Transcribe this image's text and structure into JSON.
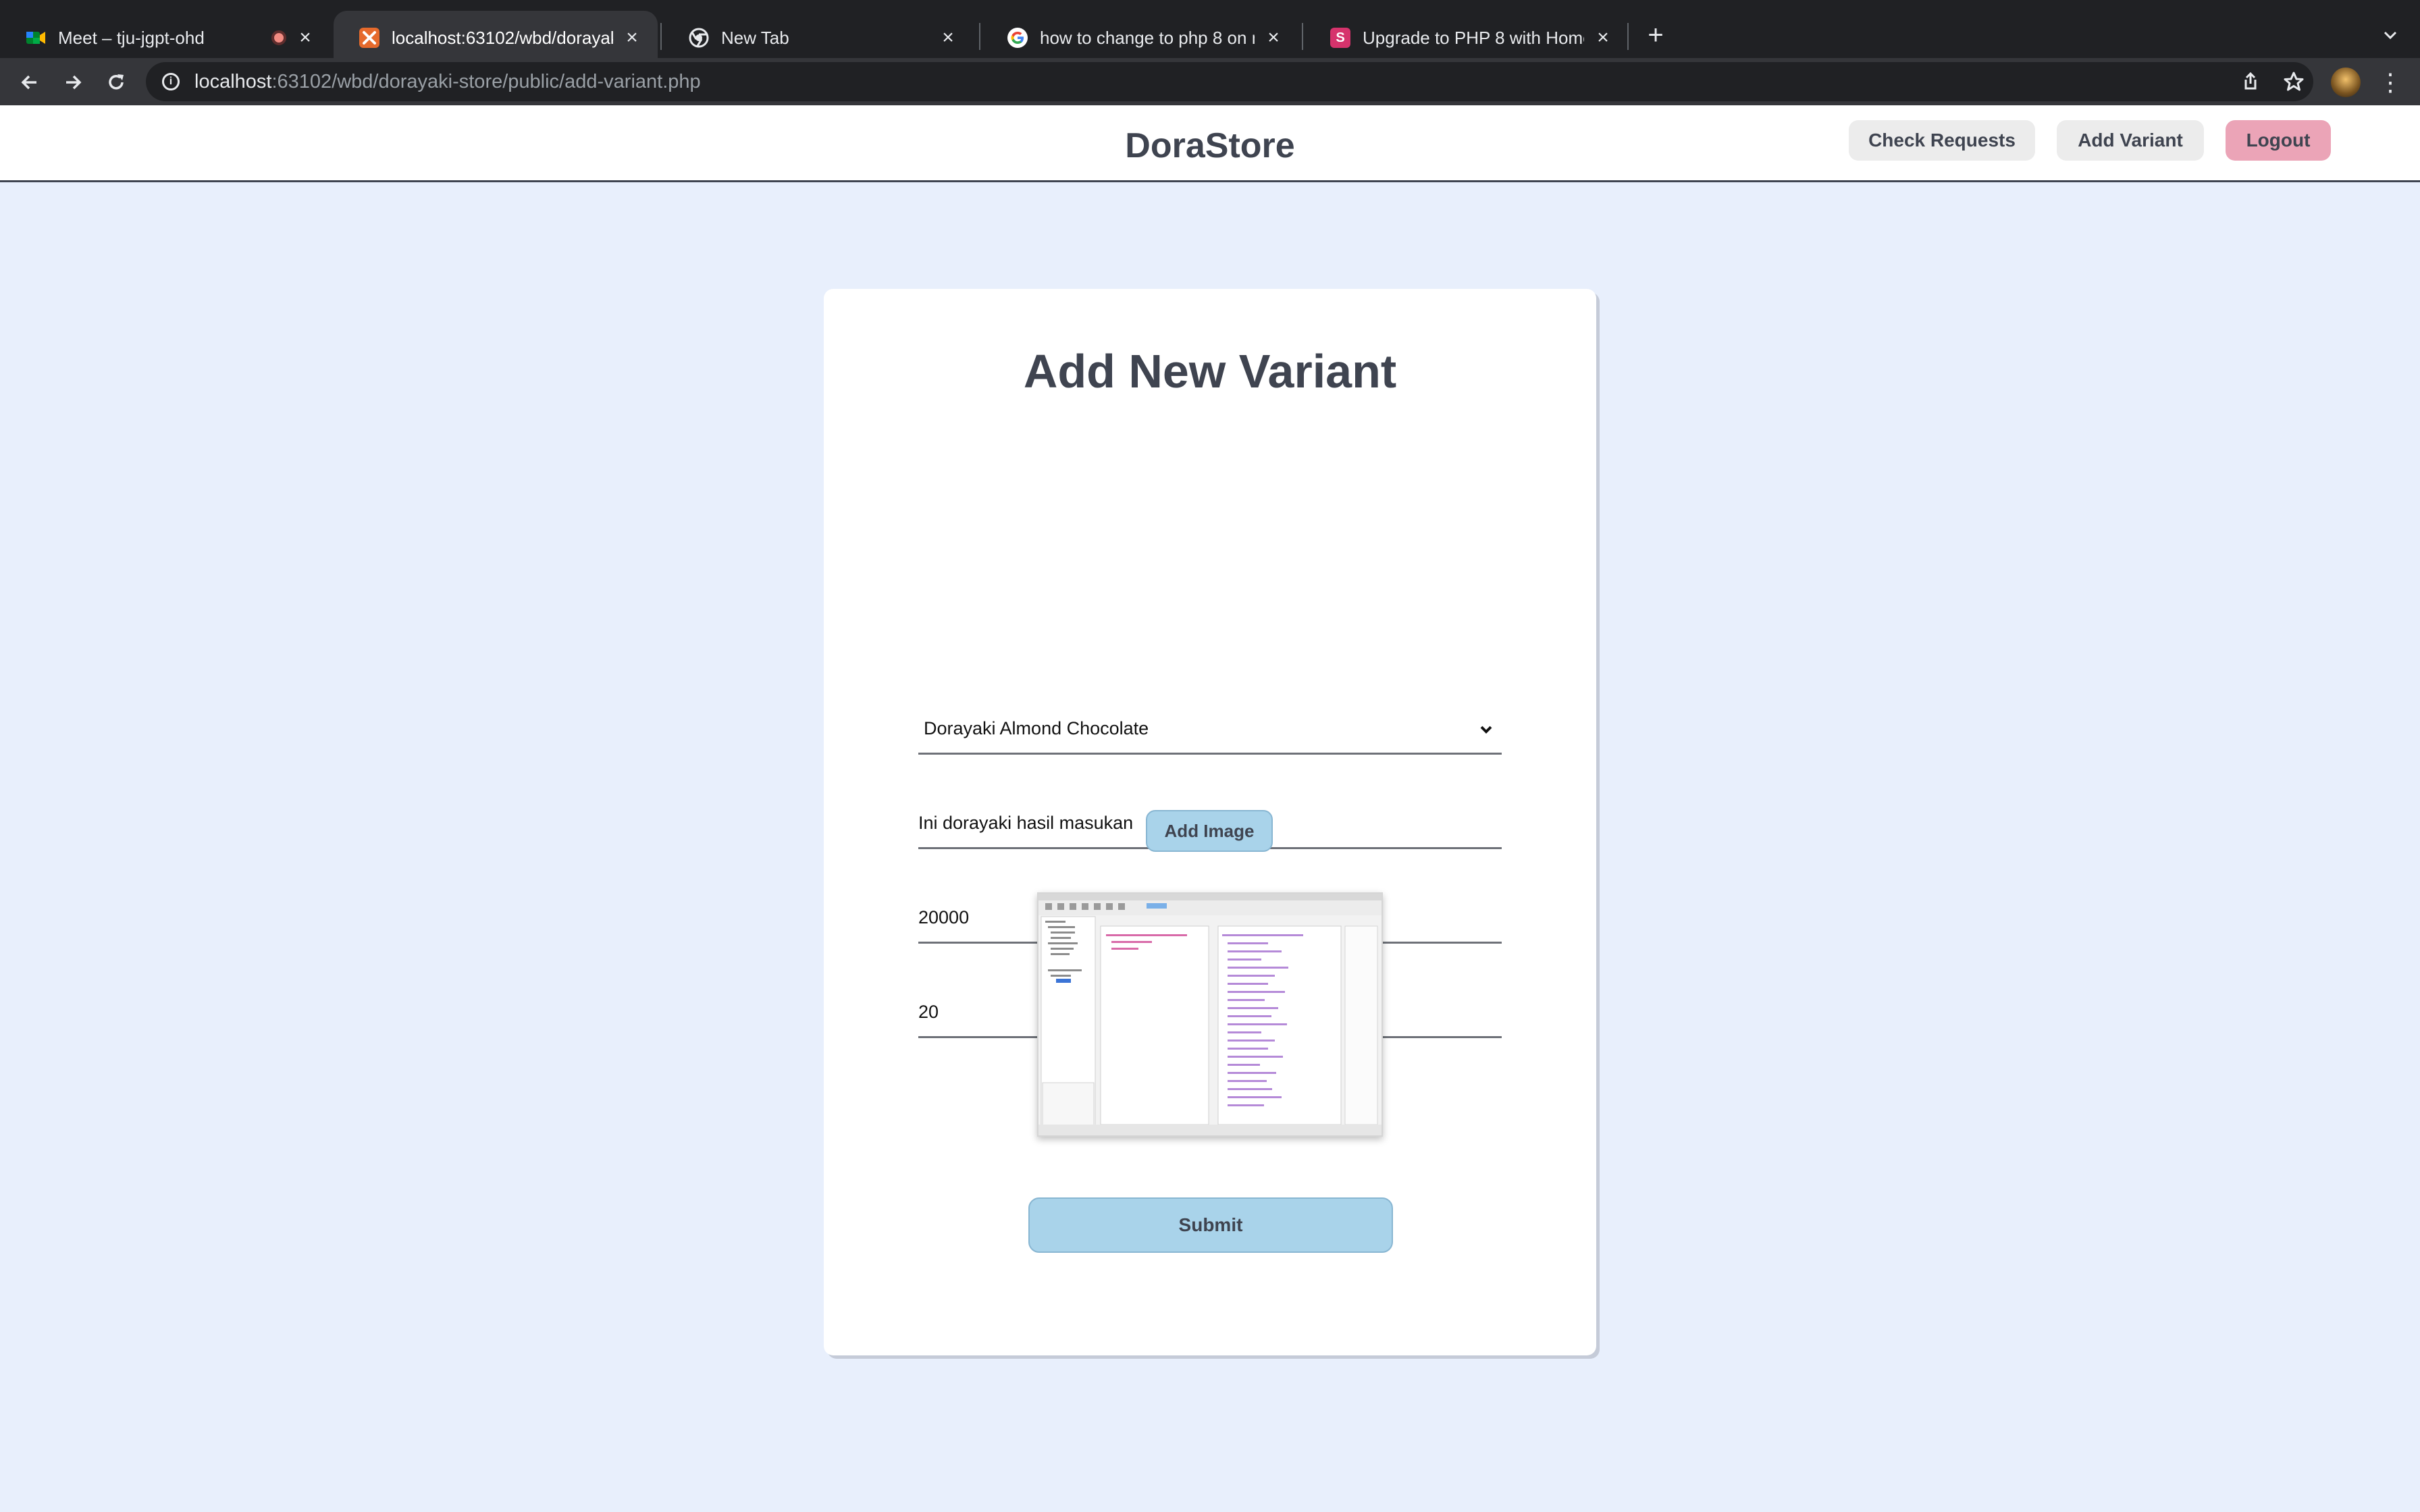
{
  "browser": {
    "tabs": [
      {
        "title": "Meet – tju-jgpt-ohd",
        "icon": "google-meet-icon",
        "recording": true
      },
      {
        "title": "localhost:63102/wbd/dorayaki-",
        "icon": "xampp-icon",
        "active": true
      },
      {
        "title": "New Tab",
        "icon": "chrome-icon"
      },
      {
        "title": "how to change to php 8 on ma",
        "icon": "google-icon"
      },
      {
        "title": "Upgrade to PHP 8 with Homeb",
        "icon": "s-icon",
        "icon_letter": "S"
      }
    ],
    "url_host": "localhost",
    "url_rest": ":63102/wbd/dorayaki-store/public/add-variant.php"
  },
  "header": {
    "brand": "DoraStore",
    "check_requests": "Check Requests",
    "add_variant": "Add Variant",
    "logout": "Logout"
  },
  "form": {
    "title": "Add New Variant",
    "selected_variant": "Dorayaki Almond Chocolate",
    "description": "Ini dorayaki hasil masukan",
    "price": "20000",
    "stock": "20",
    "add_image_label": "Add Image",
    "submit_label": "Submit"
  },
  "colors": {
    "page_bg": "#e8effc",
    "text": "#3f4450",
    "accent_blue": "#a9d3ea",
    "logout_pink": "#eba4b7"
  }
}
